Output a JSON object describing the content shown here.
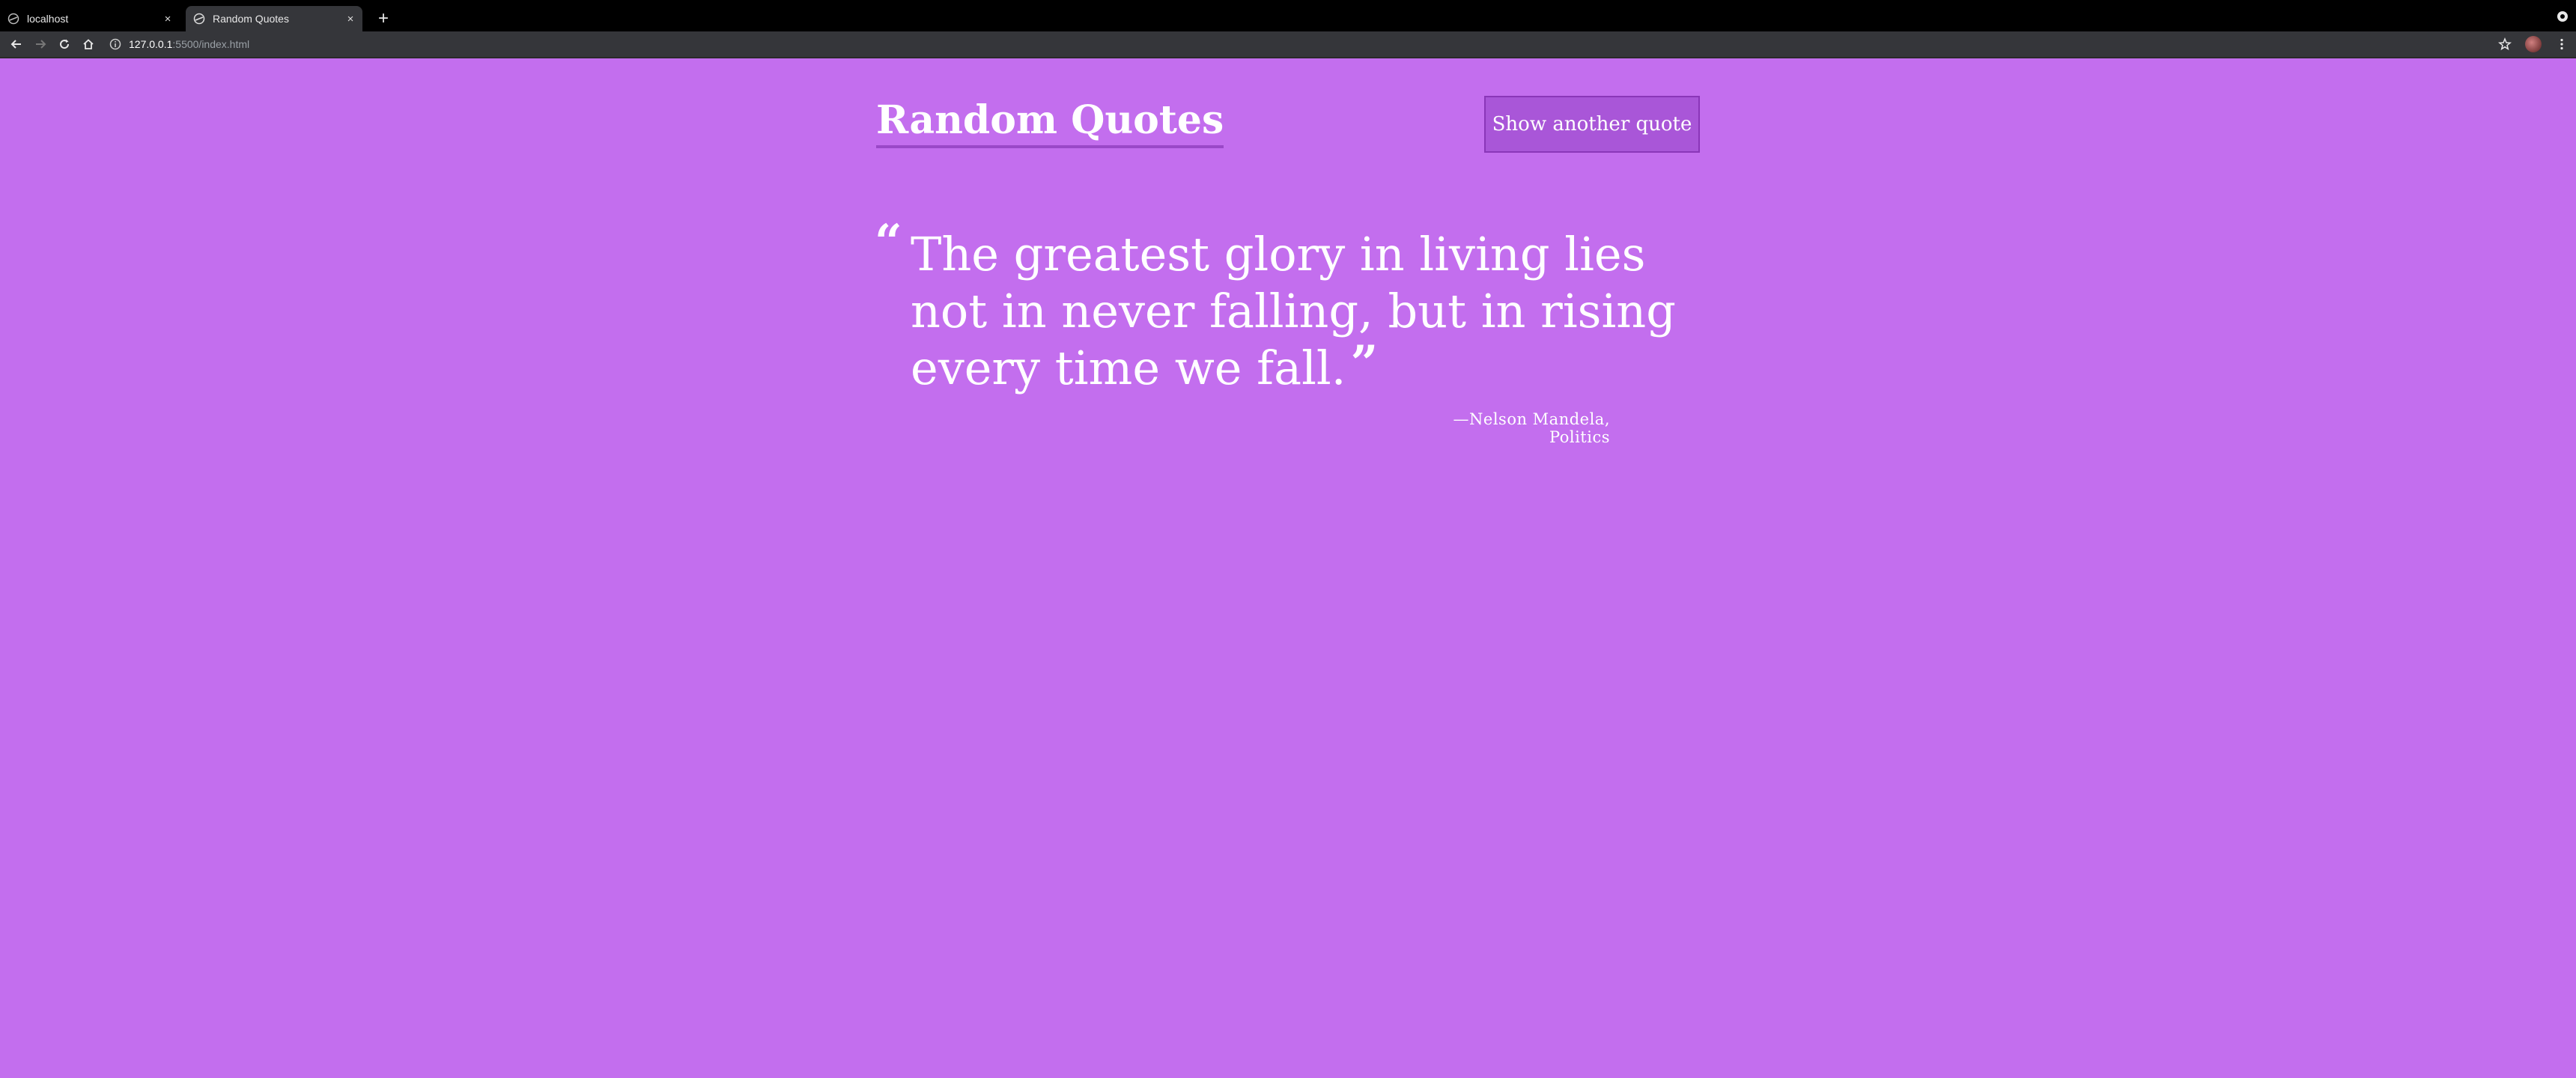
{
  "browser": {
    "tabs": [
      {
        "label": "localhost",
        "close": "×"
      },
      {
        "label": "Random Quotes",
        "close": "×"
      }
    ],
    "new_tab": "+",
    "url_host": "127.0.0.1",
    "url_rest": ":5500/index.html"
  },
  "page": {
    "title": "Random Quotes",
    "button_label": "Show another quote",
    "open_quote": "“",
    "quote_text": "The greatest glory in living lies not in never falling, but in rising every time we fall.",
    "close_quote": "”",
    "author": "—Nelson Mandela, Politics"
  },
  "colors": {
    "background": "#c36eee",
    "button_bg": "#a956d8",
    "underline": "#9a48c7",
    "text": "#ffffff"
  },
  "icons": [
    "globe-icon",
    "close-icon",
    "plus-icon",
    "back-icon",
    "forward-icon",
    "reload-icon",
    "home-icon",
    "info-icon",
    "star-icon",
    "avatar-icon",
    "menu-icon"
  ]
}
